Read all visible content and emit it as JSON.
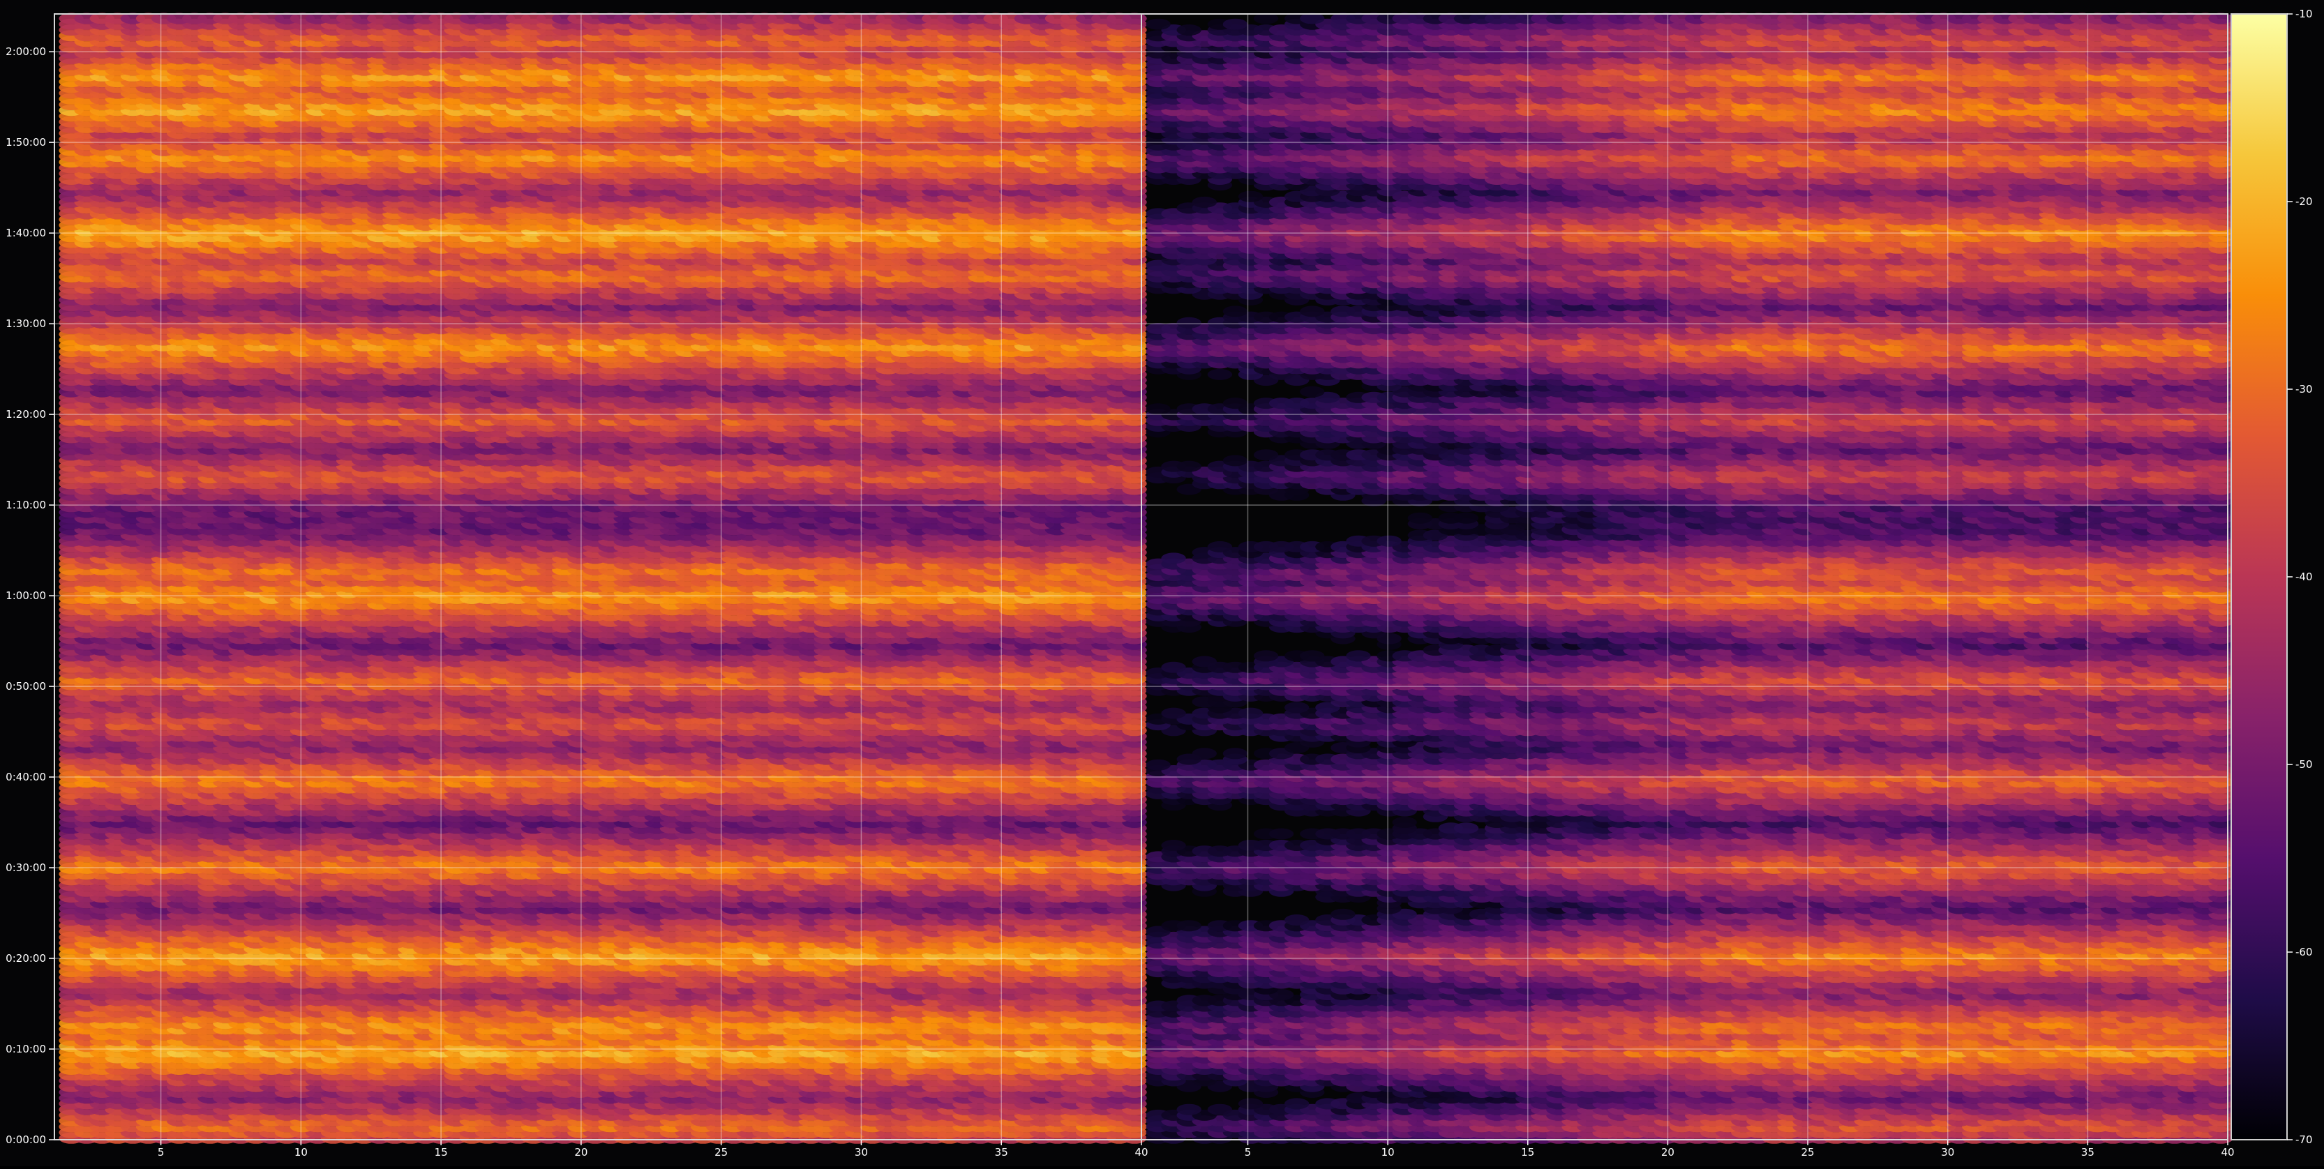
{
  "chart_data": {
    "type": "heatmap",
    "title": "",
    "xlabel": "",
    "ylabel": "",
    "colormap": "inferno",
    "background": "#050506",
    "grid": true,
    "panels": [
      {
        "name": "",
        "x_range": [
          1.2,
          40
        ],
        "x_ticks": [
          5,
          10,
          15,
          20,
          25,
          30,
          35,
          40
        ],
        "x_tick_labels": [
          "5",
          "10",
          "15",
          "20",
          "25",
          "30",
          "35",
          "40"
        ],
        "mask_left_of_x": null
      },
      {
        "name": "",
        "x_range": [
          1.2,
          40
        ],
        "x_ticks": [
          5,
          10,
          15,
          20,
          25,
          30,
          35,
          40
        ],
        "x_tick_labels": [
          "5",
          "10",
          "15",
          "20",
          "25",
          "30",
          "35",
          "40"
        ],
        "mask_left_of_x": 15
      }
    ],
    "y_range_seconds": [
      0,
      7450
    ],
    "y_ticks_seconds": [
      0,
      600,
      1200,
      1800,
      2400,
      3000,
      3600,
      4200,
      4800,
      5400,
      6000,
      6600,
      7200
    ],
    "y_tick_labels": [
      "0:00:00",
      "0:10:00",
      "0:20:00",
      "0:30:00",
      "0:40:00",
      "0:50:00",
      "1:00:00",
      "1:10:00",
      "1:20:00",
      "1:30:00",
      "1:40:00",
      "1:50:00",
      "2:00:00"
    ],
    "colorbar": {
      "range": [
        -70,
        -10
      ],
      "ticks": [
        -10,
        -20,
        -30,
        -40,
        -50,
        -60,
        -70
      ],
      "tick_labels": [
        "-10",
        "-20",
        "-30",
        "-40",
        "-50",
        "-60",
        "-70"
      ]
    },
    "bright_bands": [
      {
        "time_seconds": 7280,
        "level": -31
      },
      {
        "time_seconds": 7040,
        "level": -24
      },
      {
        "time_seconds": 6820,
        "level": -22
      },
      {
        "time_seconds": 6500,
        "level": -25
      },
      {
        "time_seconds": 6000,
        "level": -21
      },
      {
        "time_seconds": 5730,
        "level": -29
      },
      {
        "time_seconds": 5250,
        "level": -24
      },
      {
        "time_seconds": 4770,
        "level": -32
      },
      {
        "time_seconds": 4400,
        "level": -33
      },
      {
        "time_seconds": 3760,
        "level": -28
      },
      {
        "time_seconds": 3600,
        "level": -23
      },
      {
        "time_seconds": 3040,
        "level": -30
      },
      {
        "time_seconds": 2760,
        "level": -34
      },
      {
        "time_seconds": 2380,
        "level": -27
      },
      {
        "time_seconds": 1810,
        "level": -27
      },
      {
        "time_seconds": 1220,
        "level": -22
      },
      {
        "time_seconds": 750,
        "level": -24
      },
      {
        "time_seconds": 580,
        "level": -21
      },
      {
        "time_seconds": 90,
        "level": -30
      }
    ]
  }
}
